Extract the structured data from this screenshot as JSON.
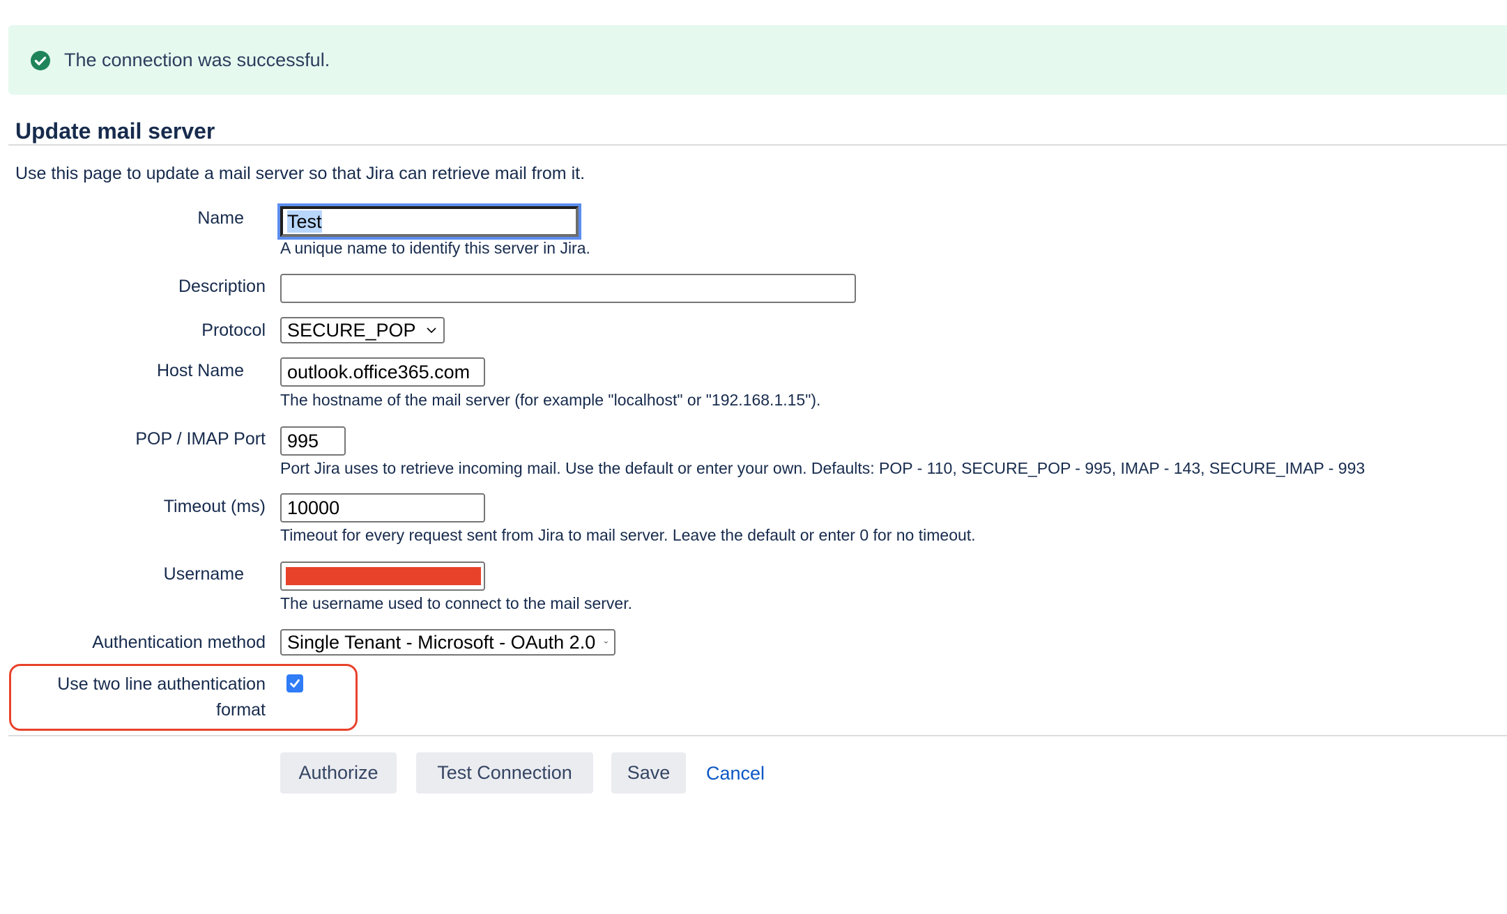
{
  "banner": {
    "message": "The connection was successful.",
    "icon": "check-circle-icon",
    "color": "#1f845a"
  },
  "page": {
    "title": "Update mail server",
    "intro": "Use this page to update a mail server so that Jira can retrieve mail from it."
  },
  "form": {
    "name": {
      "label": "Name",
      "value": "Test",
      "help": "A unique name to identify this server in Jira."
    },
    "description": {
      "label": "Description",
      "value": ""
    },
    "protocol": {
      "label": "Protocol",
      "value": "SECURE_POP"
    },
    "host": {
      "label": "Host Name",
      "value": "outlook.office365.com",
      "help": "The hostname of the mail server (for example \"localhost\" or \"192.168.1.15\")."
    },
    "port": {
      "label": "POP / IMAP Port",
      "value": "995",
      "help": "Port Jira uses to retrieve incoming mail. Use the default or enter your own. Defaults: POP - 110, SECURE_POP - 995, IMAP - 143, SECURE_IMAP - 993"
    },
    "timeout": {
      "label": "Timeout (ms)",
      "value": "10000",
      "help": "Timeout for every request sent from Jira to mail server. Leave the default or enter 0 for no timeout."
    },
    "username": {
      "label": "Username",
      "value": "[redacted]",
      "help": "The username used to connect to the mail server."
    },
    "auth_method": {
      "label": "Authentication method",
      "value": "Single Tenant - Microsoft - OAuth 2.0"
    },
    "two_line_auth": {
      "label_line1": "Use two line authentication",
      "label_line2": "format",
      "checked": true
    }
  },
  "actions": {
    "authorize": "Authorize",
    "test_connection": "Test Connection",
    "save": "Save",
    "cancel": "Cancel"
  },
  "colors": {
    "banner_bg": "#e6f9ef",
    "success": "#1f845a",
    "highlight": "#e8422b",
    "checkbox": "#2f7cf6",
    "link": "#0c57c4"
  }
}
